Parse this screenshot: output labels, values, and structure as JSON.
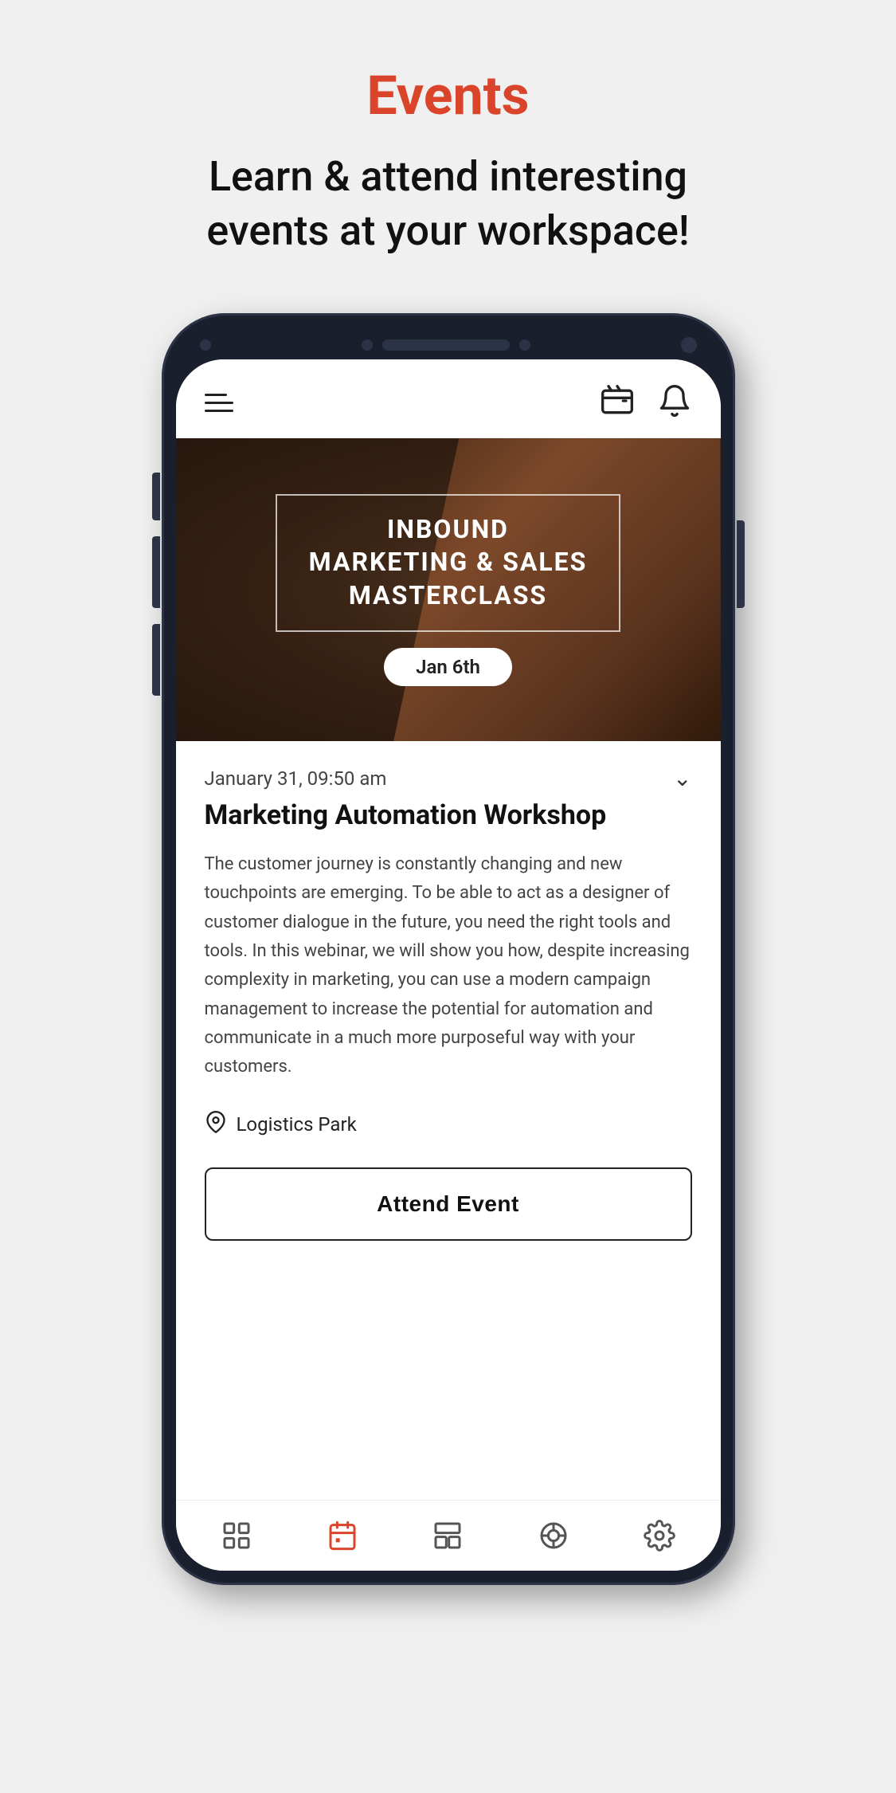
{
  "page": {
    "title": "Events",
    "subtitle": "Learn & attend interesting events at your workspace!"
  },
  "header": {
    "wallet_label": "wallet",
    "bell_label": "notifications"
  },
  "banner": {
    "title": "INBOUND\nMARKETING & SALES\nMASTERCLASS",
    "date_label": "Jan 6th"
  },
  "event": {
    "datetime": "January 31, 09:50 am",
    "title": "Marketing Automation Workshop",
    "description": "The customer journey is constantly changing and new touchpoints are emerging. To be able to act as a designer of customer dialogue in the future, you need the right tools and tools. In this webinar, we will show you how, despite increasing complexity in marketing, you can use a modern campaign management to increase the potential for automation and communicate in a much more purposeful way with your customers.",
    "location": "Logistics Park",
    "attend_button_label": "Attend Event"
  },
  "bottom_nav": {
    "items": [
      {
        "id": "home",
        "label": "home"
      },
      {
        "id": "calendar",
        "label": "calendar"
      },
      {
        "id": "workspace",
        "label": "workspace"
      },
      {
        "id": "support",
        "label": "support"
      },
      {
        "id": "settings",
        "label": "settings"
      }
    ]
  }
}
